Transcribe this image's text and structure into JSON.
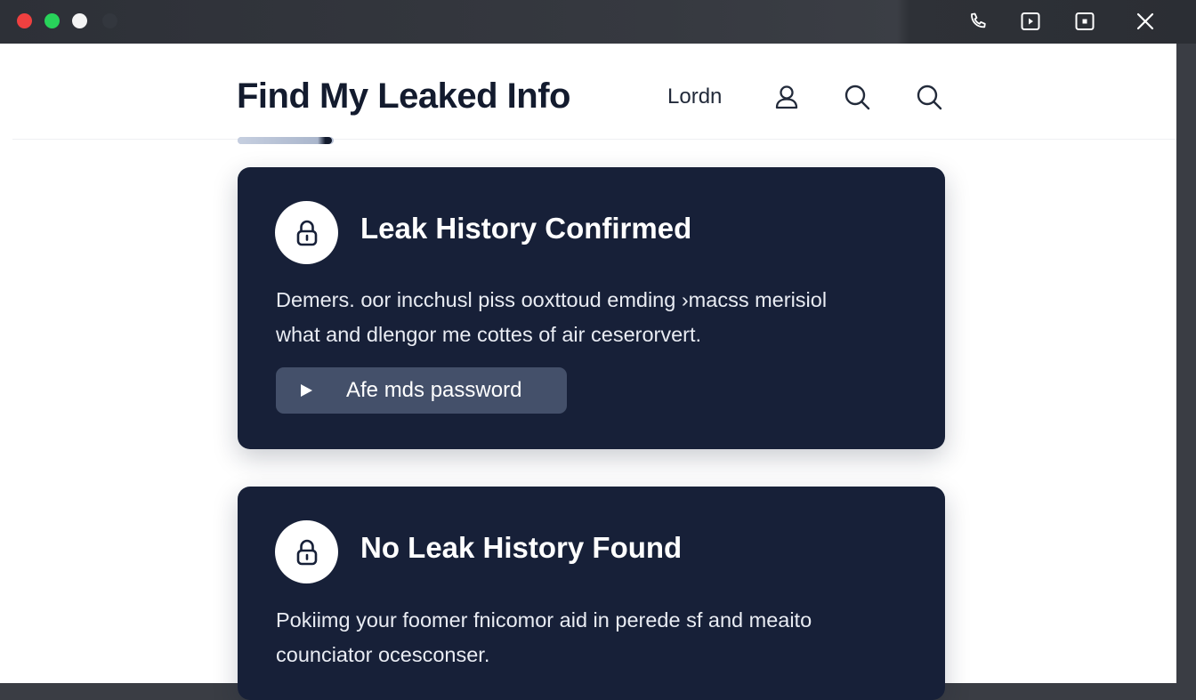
{
  "app": {
    "title": "Find My Leaked Info",
    "accent_color": "#131b2e",
    "title_underline_progress": 0.98
  },
  "titlebar": {
    "controls": [
      "close-dot",
      "maximize-dot",
      "minimize-dot",
      "inactive-dot"
    ],
    "icons": [
      "phone-icon",
      "play-window-icon",
      "stop-window-icon",
      "close-icon"
    ]
  },
  "header": {
    "login_label": "Lordn",
    "icons": [
      "user-icon",
      "search-icon",
      "search-icon"
    ]
  },
  "cards": [
    {
      "title": "Leak History Confirmed",
      "body_line_1": "Demers. oor incchusl piss ooxttoud emding ›macss merisiol",
      "body_line_2": "what and dlengor me cottes of air ceserorvert.",
      "button_label": "Afe mds password",
      "icon": "lock-icon",
      "background": "#172038"
    },
    {
      "title": "No Leak History Found",
      "body_line_1": "Pokiimg your foomer fnicomor aid in perede sf and meaito",
      "body_line_2": "counciator ocesconser.",
      "icon": "lock-icon",
      "background": "#172038"
    }
  ]
}
